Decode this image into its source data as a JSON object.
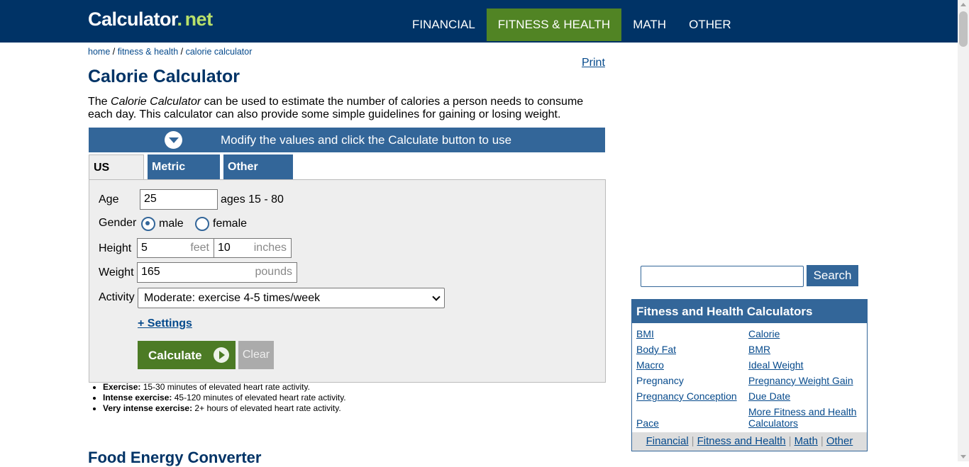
{
  "header": {
    "logo_main": "Calculator",
    "logo_dot": ".",
    "logo_net": "net",
    "nav": [
      "FINANCIAL",
      "FITNESS & HEALTH",
      "MATH",
      "OTHER"
    ],
    "active_nav": "FITNESS & HEALTH"
  },
  "breadcrumb": {
    "home": "home",
    "sep": " / ",
    "fitness": "fitness & health",
    "current": "calorie calculator"
  },
  "print_label": "Print",
  "title": "Calorie Calculator",
  "intro": {
    "pre": "The ",
    "em": "Calorie Calculator",
    "post": " can be used to estimate the number of calories a person needs to consume each day. This calculator can also provide some simple guidelines for gaining or losing weight."
  },
  "modify_bar": "Modify the values and click the Calculate button to use",
  "tabs": [
    "US Units",
    "Metric Units",
    "Other Units"
  ],
  "form": {
    "age_label": "Age",
    "age_value": "25",
    "age_hint": "ages 15 - 80",
    "gender_label": "Gender",
    "gender_male": "male",
    "gender_female": "female",
    "height_label": "Height",
    "height_feet": "5",
    "feet_unit": "feet",
    "height_inches": "10",
    "inches_unit": "inches",
    "weight_label": "Weight",
    "weight_value": "165",
    "weight_unit": "pounds",
    "activity_label": "Activity",
    "activity_value": "Moderate: exercise 4-5 times/week",
    "settings_link": "+ Settings",
    "calculate": "Calculate",
    "clear": "Clear"
  },
  "notes": [
    {
      "term": "Exercise:",
      "desc": " 15-30 minutes of elevated heart rate activity."
    },
    {
      "term": "Intense exercise:",
      "desc": " 45-120 minutes of elevated heart rate activity."
    },
    {
      "term": "Very intense exercise:",
      "desc": " 2+ hours of elevated heart rate activity."
    }
  ],
  "next_heading": "Food Energy Converter",
  "search": {
    "button": "Search",
    "value": ""
  },
  "fh_panel": {
    "title": "Fitness and Health Calculators",
    "left": [
      "BMI",
      "Body Fat",
      "Macro",
      "Pregnancy",
      "Pregnancy Conception",
      "Pace"
    ],
    "right": [
      "Calorie",
      "BMR",
      "Ideal Weight",
      "Pregnancy Weight Gain",
      "Due Date",
      "More Fitness and Health",
      "Calculators"
    ],
    "footer": [
      "Financial",
      "Fitness and Health",
      "Math",
      "Other"
    ],
    "footer_sep": "|"
  },
  "colors": {
    "navy": "#003366",
    "green": "#518424",
    "blue": "#336699"
  }
}
